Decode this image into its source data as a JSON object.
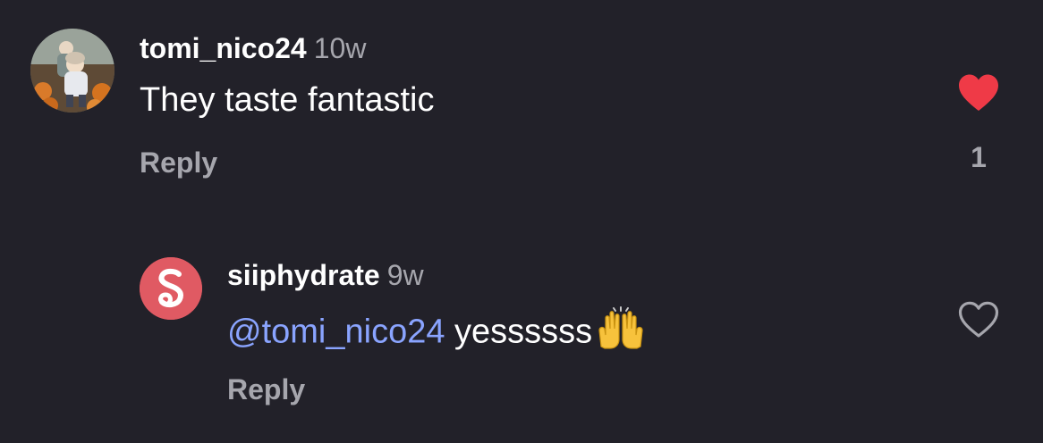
{
  "comments": [
    {
      "username": "tomi_nico24",
      "time": "10w",
      "text": "They taste fantastic",
      "reply_label": "Reply",
      "liked": true,
      "like_count": "1",
      "like_color": "#ef3a47",
      "like_icon": "heart-filled-icon"
    }
  ],
  "replies": [
    {
      "username": "siiphydrate",
      "time": "9w",
      "mention": "@tomi_nico24",
      "text": "yessssss",
      "emoji": "raising-hands-emoji",
      "reply_label": "Reply",
      "liked": false,
      "like_icon": "heart-outline-icon",
      "avatar_color": "#e05a63"
    }
  ],
  "colors": {
    "background": "#222129",
    "muted_text": "#a6a6ad",
    "mention": "#8aa4ff"
  }
}
